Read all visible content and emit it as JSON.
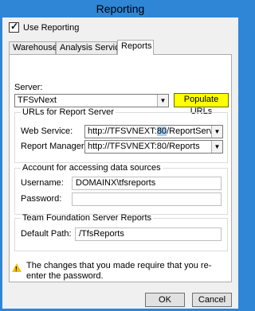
{
  "window": {
    "title": "Reporting"
  },
  "use_reporting": {
    "label": "Use Reporting",
    "checked": true
  },
  "tabs": [
    {
      "label": "Warehouse",
      "active": false
    },
    {
      "label": "Analysis Services",
      "active": false
    },
    {
      "label": "Reports",
      "active": true
    }
  ],
  "server": {
    "label": "Server:",
    "value": "TFSvNext",
    "populate_button": "Populate URLs"
  },
  "urls_group": {
    "legend": "URLs for Report Server",
    "web_service": {
      "label": "Web Service:",
      "prefix": "http://TFSVNEXT:",
      "port": "80",
      "suffix": "/ReportServer"
    },
    "report_manager": {
      "label": "Report Manager:",
      "value": "http://TFSVNEXT:80/Reports"
    }
  },
  "account_group": {
    "legend": "Account for accessing data sources",
    "username": {
      "label": "Username:",
      "value": "DOMAINX\\tfsreports"
    },
    "password": {
      "label": "Password:",
      "value": ""
    }
  },
  "tfs_reports_group": {
    "legend": "Team Foundation Server Reports",
    "default_path": {
      "label": "Default Path:",
      "value": "/TfsReports"
    }
  },
  "warning": {
    "text": "The changes that you made require that you re-enter the password."
  },
  "buttons": {
    "ok": "OK",
    "cancel": "Cancel"
  },
  "colors": {
    "title_bar": "#2f86d6",
    "highlight": "#ffff00",
    "selection": "#a8d0f6"
  }
}
